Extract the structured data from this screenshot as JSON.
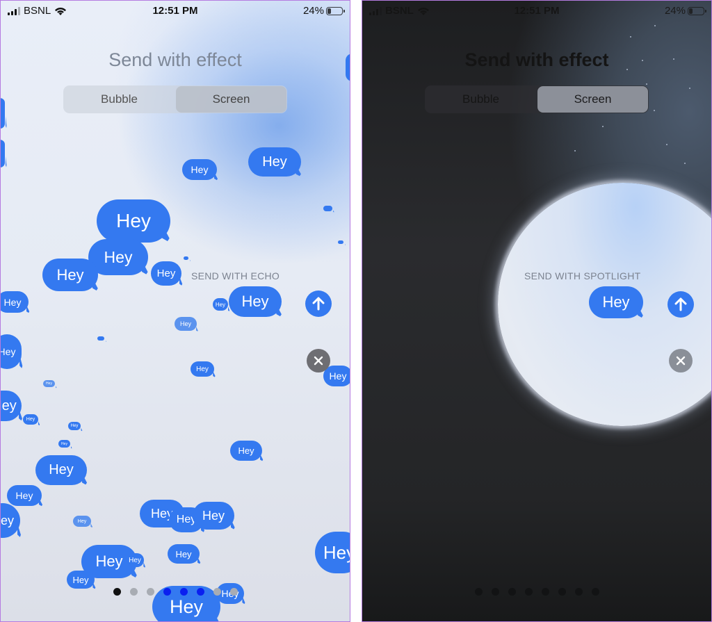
{
  "status_bar": {
    "carrier": "BSNL",
    "time": "12:51 PM",
    "battery_percent": "24%",
    "battery_level": 0.24
  },
  "left": {
    "title": "Send with effect",
    "segments": [
      {
        "label": "Bubble",
        "selected": false
      },
      {
        "label": "Screen",
        "selected": true
      }
    ],
    "effect_label": "SEND WITH ECHO",
    "message": "Hey",
    "echo_bubble_text": "Hey",
    "page_dots": {
      "count": 8,
      "active_index": 0
    }
  },
  "right": {
    "title": "Send with effect",
    "segments": [
      {
        "label": "Bubble",
        "selected": false
      },
      {
        "label": "Screen",
        "selected": true
      }
    ],
    "effect_label": "SEND WITH SPOTLIGHT",
    "message": "Hey",
    "page_dots": {
      "count": 8,
      "active_index": null
    }
  },
  "colors": {
    "accent": "#3479f0",
    "frame": "#b57be0"
  },
  "icons": {
    "send": "arrow-up-icon",
    "close": "close-icon",
    "signal": "signal-icon",
    "wifi": "wifi-icon",
    "battery": "battery-icon"
  }
}
